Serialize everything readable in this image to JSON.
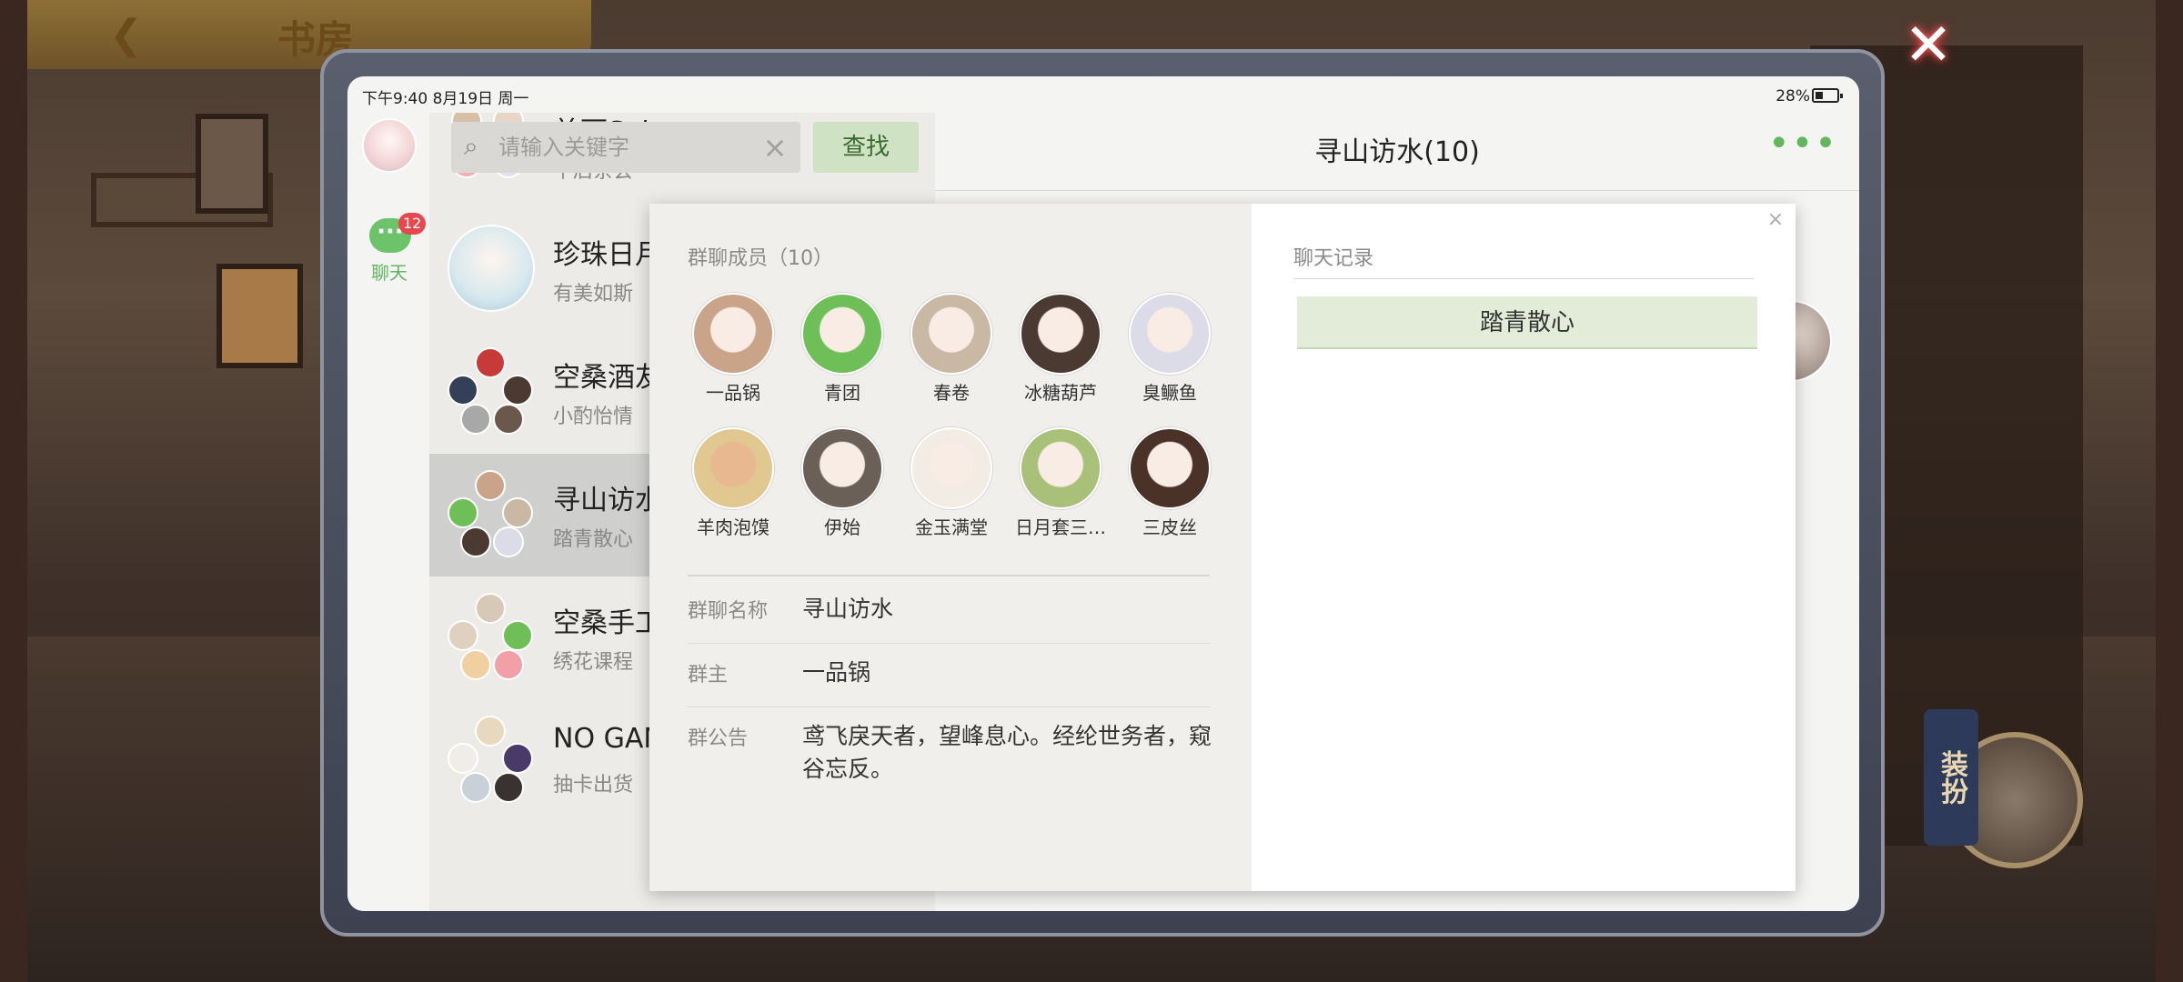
{
  "game": {
    "top_title": "书房",
    "dress_label": "装扮"
  },
  "status_bar": {
    "time": "下午9:40  8月19日  周一",
    "battery": "28%"
  },
  "rail": {
    "chat_label": "聊天",
    "chat_badge": "12"
  },
  "search": {
    "placeholder": "请输入关键字",
    "button_label": "查找"
  },
  "chat_list": [
    {
      "title": "美丽Salon",
      "subtitle": "午后茶会"
    },
    {
      "title": "珍珠日月",
      "subtitle": "有美如斯"
    },
    {
      "title": "空桑酒友",
      "subtitle": "小酌怡情"
    },
    {
      "title": "寻山访水",
      "subtitle": "踏青散心"
    },
    {
      "title": "空桑手工",
      "subtitle": "绣花课程"
    },
    {
      "title": "NO GAM",
      "subtitle": "抽卡出货"
    }
  ],
  "chat_header": {
    "title": "寻山访水(10)"
  },
  "modal": {
    "members_title": "群聊成员（10）",
    "members": [
      {
        "name": "一品锅",
        "color": "#c9a488"
      },
      {
        "name": "青团",
        "color": "#6fbf58"
      },
      {
        "name": "春卷",
        "color": "#c8b8a4"
      },
      {
        "name": "冰糖葫芦",
        "color": "#4a3a32"
      },
      {
        "name": "臭鳜鱼",
        "color": "#dcdce8"
      },
      {
        "name": "羊肉泡馍",
        "color": "#e0c890"
      },
      {
        "name": "伊始",
        "color": "#6a6058"
      },
      {
        "name": "金玉满堂",
        "color": "#f2ece4"
      },
      {
        "name": "日月套三…",
        "color": "#a8c078"
      },
      {
        "name": "三皮丝",
        "color": "#4a3228"
      }
    ],
    "group_name_label": "群聊名称",
    "group_name_value": "寻山访水",
    "owner_label": "群主",
    "owner_value": "一品锅",
    "notice_label": "群公告",
    "notice_value": "鸢飞戾天者，望峰息心。经纶世务者，窥谷忘反。",
    "history_title": "聊天记录",
    "history_item": "踏青散心"
  }
}
